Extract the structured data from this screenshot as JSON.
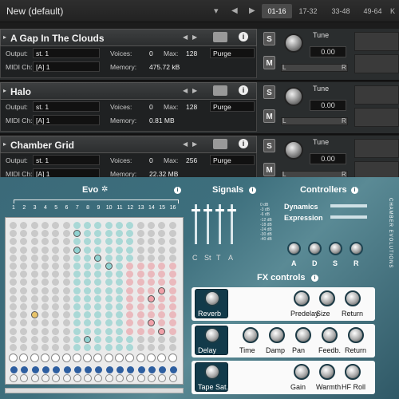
{
  "top": {
    "rack_title": "New (default)",
    "page_tabs": [
      "01-16",
      "17-32",
      "33-48",
      "49-64",
      "K"
    ]
  },
  "instruments": [
    {
      "name": "A Gap In The Clouds",
      "output_label": "Output:",
      "output": "st. 1",
      "midi_label": "MIDI Ch:",
      "midi": "[A]  1",
      "voices_label": "Voices:",
      "voices": "0",
      "max_label": "Max:",
      "max": "128",
      "memory_label": "Memory:",
      "memory": "475.72 kB",
      "purge": "Purge",
      "tune_label": "Tune",
      "tune": "0.00"
    },
    {
      "name": "Halo",
      "output_label": "Output:",
      "output": "st. 1",
      "midi_label": "MIDI Ch:",
      "midi": "[A]  1",
      "voices_label": "Voices:",
      "voices": "0",
      "max_label": "Max:",
      "max": "128",
      "memory_label": "Memory:",
      "memory": "0.81 MB",
      "purge": "Purge",
      "tune_label": "Tune",
      "tune": "0.00"
    },
    {
      "name": "Chamber Grid",
      "output_label": "Output:",
      "output": "st. 1",
      "midi_label": "MIDI Ch:",
      "midi": "[A]  1",
      "voices_label": "Voices:",
      "voices": "0",
      "max_label": "Max:",
      "max": "256",
      "memory_label": "Memory:",
      "memory": "22.32 MB",
      "purge": "Purge",
      "tune_label": "Tune",
      "tune": "0.00"
    }
  ],
  "buttons": {
    "solo": "S",
    "mute": "M",
    "info": "i",
    "L": "L",
    "R": "R"
  },
  "evo": {
    "title": "Evo",
    "columns": [
      "1",
      "2",
      "3",
      "4",
      "5",
      "6",
      "7",
      "8",
      "9",
      "10",
      "11",
      "12",
      "13",
      "14",
      "15",
      "16"
    ]
  },
  "signals": {
    "title": "Signals",
    "db_labels": [
      "0 dB",
      "-3 dB",
      "-6 dB",
      "-12 dB",
      "-18 dB",
      "-24 dB",
      "-30 dB",
      "-40 dB"
    ],
    "channels": [
      "C",
      "St",
      "T",
      "A"
    ]
  },
  "controllers": {
    "title": "Controllers",
    "sliders": [
      {
        "label": "Dynamics",
        "value": 0.0
      },
      {
        "label": "Expression",
        "value": 1.0
      }
    ],
    "adsr": [
      "A",
      "D",
      "S",
      "R"
    ],
    "brand": "CHAMBER EVOLUTIONS"
  },
  "fx": {
    "title": "FX controls",
    "rows": [
      {
        "button": "Reverb",
        "knobs": [
          "Predelay",
          "Size",
          "Return"
        ]
      },
      {
        "button": "Delay",
        "knobs": [
          "Time",
          "Damp",
          "Pan",
          "Feedb.",
          "Return"
        ]
      },
      {
        "button": "Tape Sat.",
        "knobs": [
          "Gain",
          "Warmth",
          "HF Roll"
        ]
      }
    ]
  },
  "colors": {
    "accent_teal": "#3d6f7d",
    "dot_teal": "#8fd1d0",
    "dot_pink": "#f0a0a8",
    "dot_yellow": "#e8c36a"
  }
}
